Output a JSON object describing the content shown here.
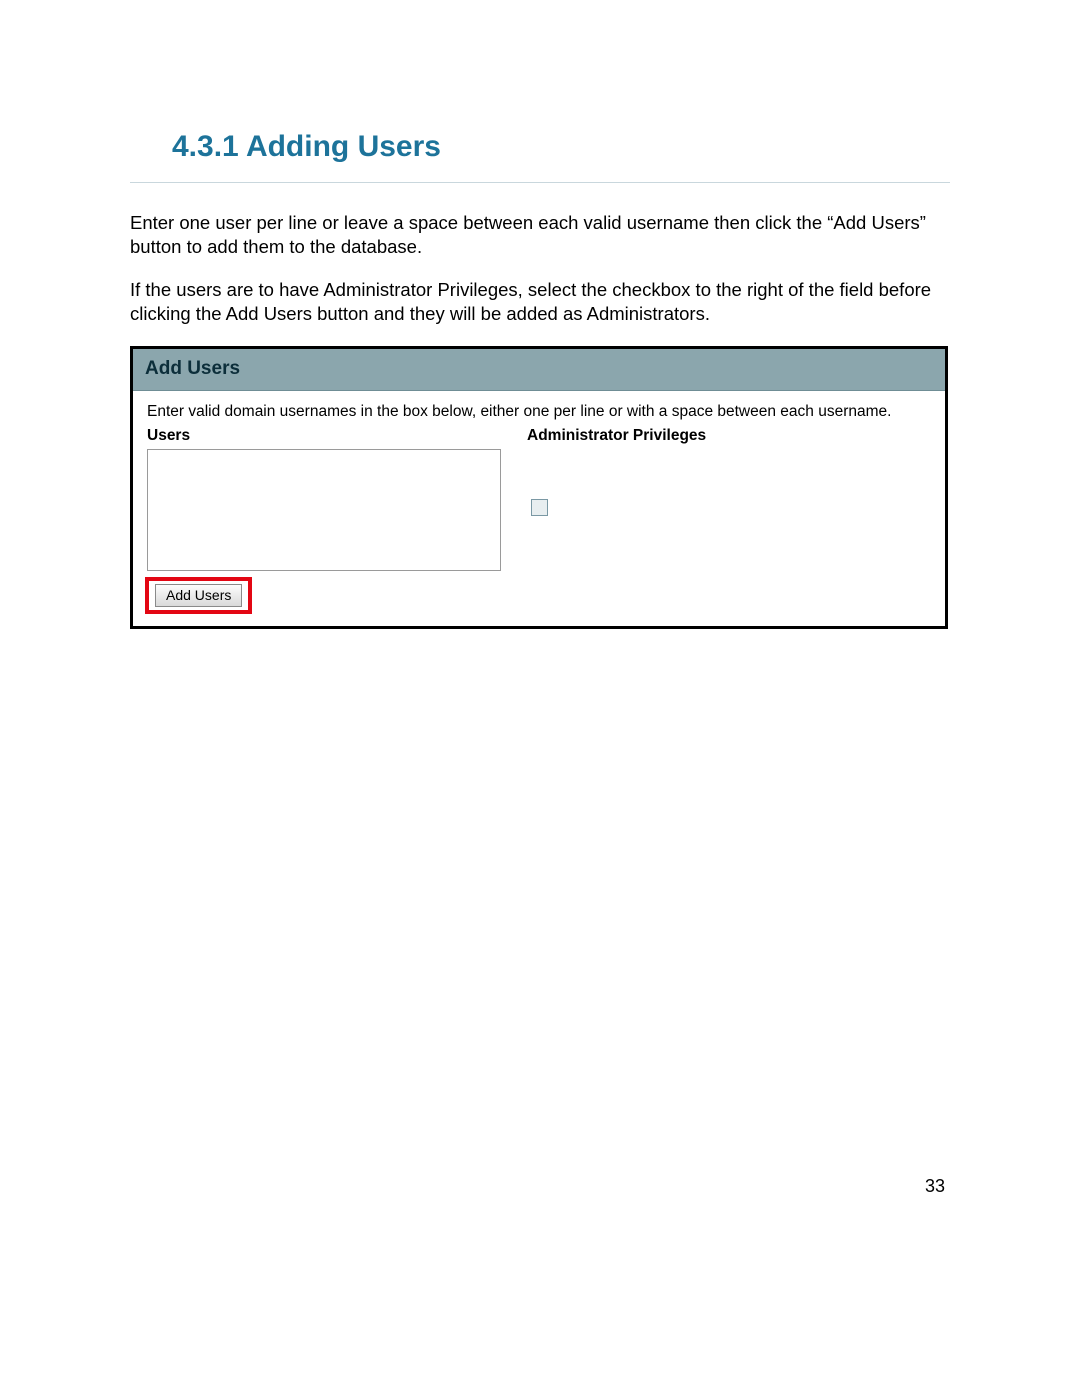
{
  "heading": "4.3.1  Adding Users",
  "para1": "Enter one user per line or leave a space between each valid username then click the “Add Users” button to add them to the database.",
  "para2": "If the users are to have Administrator Privileges, select the checkbox to the right of the field before clicking the Add Users button and they will be added as Administrators.",
  "panel": {
    "title": "Add Users",
    "helper": "Enter valid domain usernames in the box below, either one per line or with a space between each username.",
    "col_users": "Users",
    "col_admin": "Administrator Privileges",
    "textarea_value": "",
    "button_label": "Add Users"
  },
  "page_number": "33"
}
